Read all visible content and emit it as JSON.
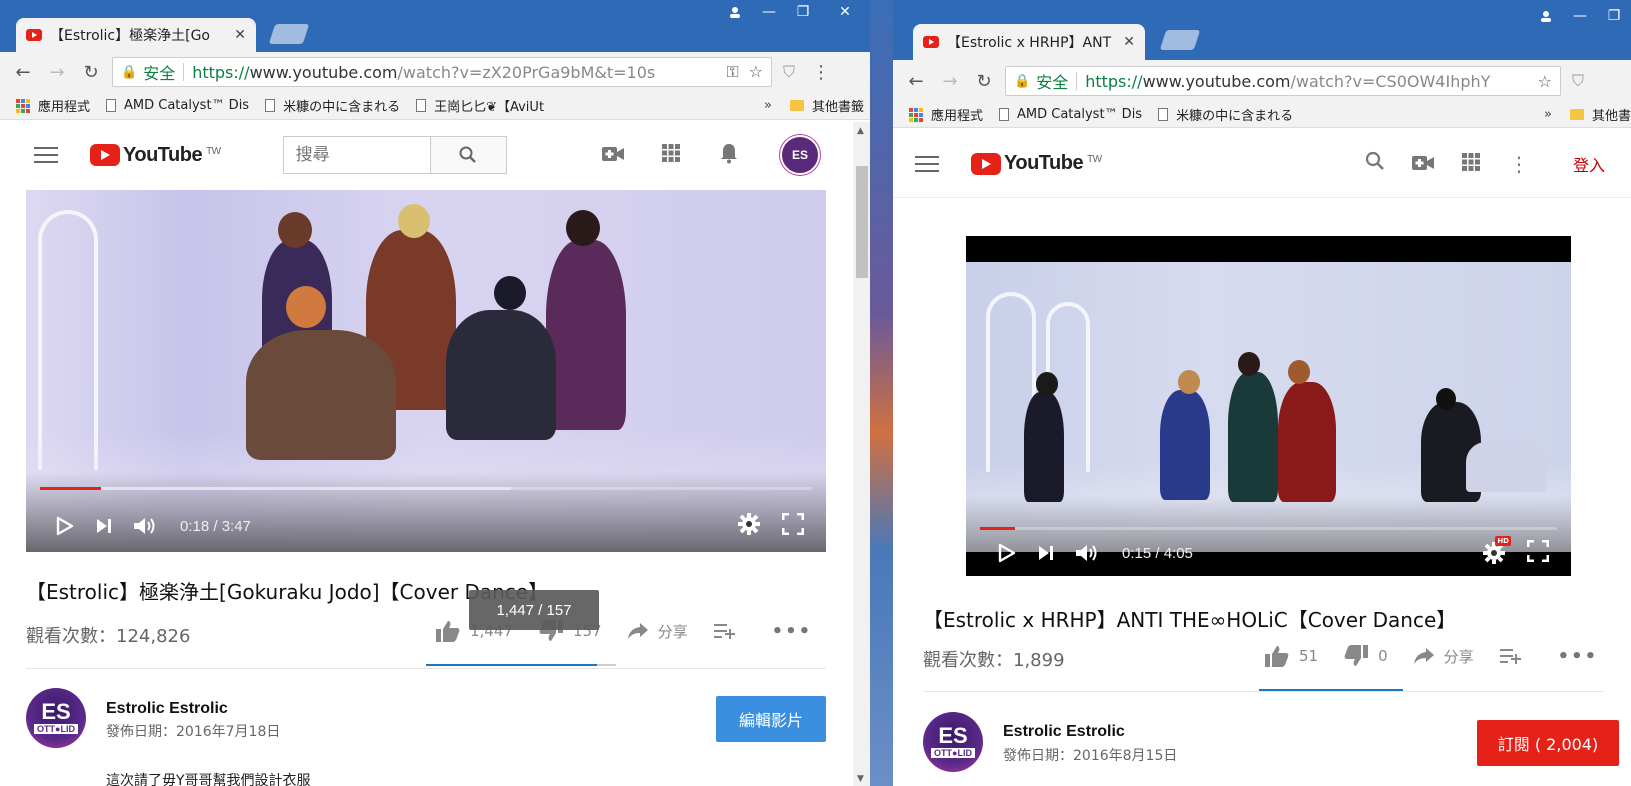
{
  "left_window": {
    "tab_title": "【Estrolic】極楽浄土[Go",
    "address": {
      "secure_label": "安全",
      "url_scheme": "https://",
      "url_host": "www.youtube.com",
      "url_path": "/watch?v=zX20PrGa9bM&t=10s"
    },
    "bookmarks": {
      "apps": "應用程式",
      "items": [
        "AMD Catalyst™ Dis",
        "米糠の中に含まれる",
        "王崗匕匕❦【AviUt"
      ],
      "more": "»",
      "other": "其他書籤"
    },
    "header": {
      "logo": "YouTube",
      "region": "TW",
      "search_placeholder": "搜尋"
    },
    "avatar_text": "ES",
    "player": {
      "time": "0:18 / 3:47",
      "progress": 0.079,
      "buffered": 0.61
    },
    "video": {
      "title": "【Estrolic】極楽浄土[Gokuraku Jodo]【Cover Dance】",
      "views": "觀看次數：124,826",
      "likes": "1,447",
      "dislikes": "157",
      "like_ratio": 0.902,
      "share": "分享",
      "tooltip": "1,447 / 157",
      "more": "•••"
    },
    "owner": {
      "avatar_big": "ES",
      "avatar_small": "OTT●LID",
      "name": "Estrolic Estrolic",
      "published": "發佈日期：2016年7月18日",
      "edit_button": "編輯影片",
      "description": "這次請了毋Y哥哥幫我們設計衣服"
    }
  },
  "right_window": {
    "tab_title": "【Estrolic x HRHP】ANT",
    "address": {
      "secure_label": "安全",
      "url_scheme": "https://",
      "url_host": "www.youtube.com",
      "url_path": "/watch?v=CS0OW4IhphY"
    },
    "bookmarks": {
      "apps": "應用程式",
      "items": [
        "AMD Catalyst™ Dis",
        "米糠の中に含まれる"
      ],
      "more": "»",
      "other": "其他書"
    },
    "header": {
      "logo": "YouTube",
      "region": "TW",
      "signin": "登入"
    },
    "player": {
      "time": "0:15 / 4:05",
      "progress": 0.061,
      "buffered": 0.0
    },
    "video": {
      "title": "【Estrolic x HRHP】ANTI THE∞HOLiC【Cover Dance】",
      "views": "觀看次數：1,899",
      "likes": "51",
      "dislikes": "0",
      "like_ratio": 1.0,
      "share": "分享",
      "more": "•••"
    },
    "owner": {
      "avatar_big": "ES",
      "avatar_small": "OTT●LID",
      "name": "Estrolic Estrolic",
      "published": "發佈日期：2016年8月15日",
      "subscribe_button": "訂閱 ( 2,004)"
    }
  },
  "colors": {
    "yt_red": "#e62117",
    "secure_green": "#0b8043",
    "like_blue": "#167ac6",
    "edit_blue": "#3a8fe0"
  }
}
